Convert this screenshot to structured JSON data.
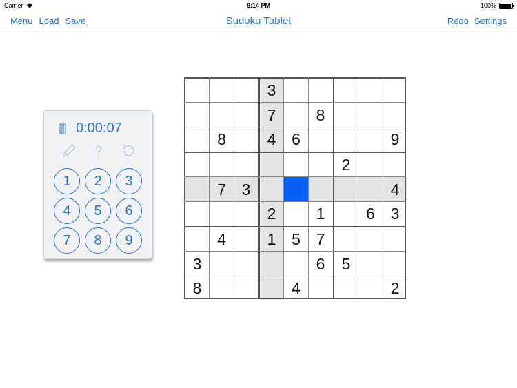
{
  "status_bar": {
    "carrier": "Carrier",
    "time": "9:14 PM",
    "battery": "100%"
  },
  "nav": {
    "menu": "Menu",
    "load": "Load",
    "save": "Save",
    "title": "Sudoku Tablet",
    "redo": "Redo",
    "settings": "Settings"
  },
  "panel": {
    "timer": "0:00:07",
    "hint_glyph": "?",
    "keys": [
      "1",
      "2",
      "3",
      "4",
      "5",
      "6",
      "7",
      "8",
      "9"
    ]
  },
  "board": {
    "rows": [
      [
        "",
        "",
        "",
        "3",
        "",
        "",
        "",
        "",
        ""
      ],
      [
        "",
        "",
        "",
        "7",
        "",
        "8",
        "",
        "",
        ""
      ],
      [
        "",
        "8",
        "",
        "4",
        "6",
        "",
        "",
        "",
        "9"
      ],
      [
        "",
        "",
        "",
        "",
        "",
        "",
        "2",
        "",
        ""
      ],
      [
        "",
        "7",
        "3",
        "",
        "",
        "",
        "",
        "",
        "4"
      ],
      [
        "",
        "",
        "",
        "2",
        "",
        "1",
        "",
        "6",
        "3"
      ],
      [
        "",
        "4",
        "",
        "1",
        "5",
        "7",
        "",
        "",
        ""
      ],
      [
        "3",
        "",
        "",
        "",
        "",
        "6",
        "5",
        "",
        ""
      ],
      [
        "8",
        "",
        "",
        "",
        "4",
        "",
        "",
        "",
        "2"
      ]
    ],
    "selected_row": 4,
    "selected_col": 4
  },
  "colors": {
    "accent": "#2f74d0",
    "selected_cell": "#0a5ff4",
    "highlight": "#e4e4e4"
  }
}
